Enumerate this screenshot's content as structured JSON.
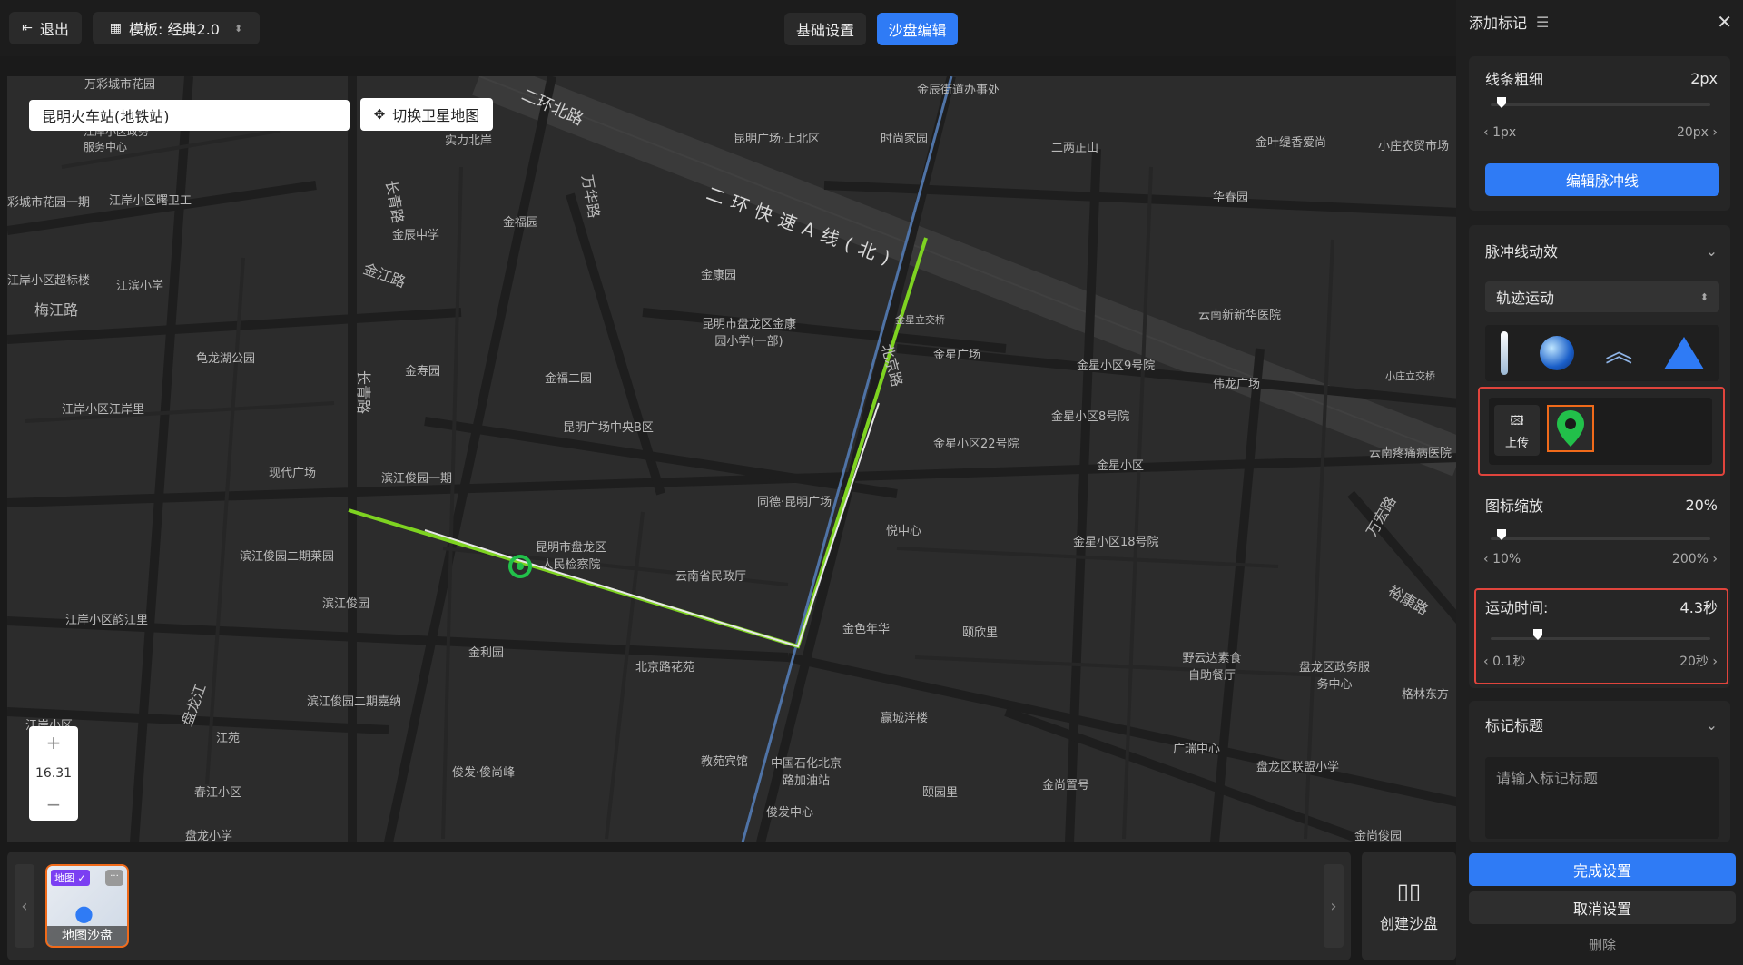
{
  "topbar": {
    "exit_label": "退出",
    "template_label": "模板: 经典2.0",
    "tab_basic": "基础设置",
    "tab_sandbox": "沙盘编辑"
  },
  "map": {
    "search_value": "昆明火车站(地铁站)",
    "satellite_button": "切换卫星地图",
    "zoom_plus": "+",
    "zoom_level": "16.31",
    "zoom_minus": "−",
    "labels": [
      "万彩城市花园",
      "江岸小区政务服务中心",
      "实力北岸",
      "金辰街道办事处",
      "二环北路",
      "昆明广场·上北区",
      "时尚家园",
      "二两正山",
      "金叶缇香爱尚",
      "小庄农贸市场",
      "二环快速A线(北)",
      "彩城市花园一期",
      "江岸小区曙卫工",
      "金辰中学",
      "金福园",
      "万华路",
      "长青路",
      "金江路",
      "华春园",
      "江岸小区超标楼",
      "江滨小学",
      "梅江路",
      "金康园",
      "昆明市盘龙区金康园小学(一部)",
      "云南新新华医院",
      "金星立交桥",
      "龟龙湖公园",
      "金寿园",
      "金福二园",
      "北京路",
      "金星广场",
      "金星小区9号院",
      "伟龙广场",
      "小庄立交桥",
      "江岸小区江岸里",
      "昆明广场中央B区",
      "金星小区8号院",
      "长青路",
      "现代广场",
      "滨江俊园一期",
      "金星小区22号院",
      "金星小区",
      "云南疼痛病医院",
      "同德·昆明广场",
      "悦中心",
      "滨江俊园二期莱园",
      "昆明市盘龙区人民检察院",
      "云南省民政厅",
      "金星小区18号院",
      "万宏路",
      "滨江俊园",
      "裕康路",
      "江岸小区韵江里",
      "金利园",
      "金色年华",
      "颐欣里",
      "北京路花苑",
      "野云达素食自助餐厅",
      "盘龙区政务服务中心",
      "滨江俊园二期嘉纳",
      "格林东方",
      "江岸小区",
      "赢城洋楼",
      "盘龙江",
      "江苑",
      "教苑宾馆",
      "中国石化北京路加油站",
      "广瑞中心",
      "盘龙区联盟小学",
      "俊发·俊尚峰",
      "春江小区",
      "颐园里",
      "金尚置号",
      "盘龙小学",
      "俊发中心",
      "金尚俊园"
    ]
  },
  "bottom": {
    "thumb_badge": "地图",
    "thumb_label": "地图沙盘",
    "create_label": "创建沙盘"
  },
  "panel": {
    "title": "添加标记",
    "line_width_label": "线条粗细",
    "line_width_value": "2px",
    "line_min": "1px",
    "line_max": "20px",
    "edit_pulse_btn": "编辑脉冲线",
    "pulse_effect_label": "脉冲线动效",
    "motion_select": "轨迹运动",
    "upload_label": "上传",
    "icon_scale_label": "图标缩放",
    "icon_scale_value": "20%",
    "icon_scale_min": "10%",
    "icon_scale_max": "200%",
    "motion_time_label": "运动时间:",
    "motion_time_value": "4.3秒",
    "motion_time_min": "0.1秒",
    "motion_time_max": "20秒",
    "marker_title_label": "标记标题",
    "marker_title_placeholder": "请输入标记标题",
    "done_btn": "完成设置",
    "cancel_btn": "取消设置",
    "delete_btn": "删除"
  },
  "colors": {
    "accent": "#2f7bf5",
    "highlight": "#e0443c",
    "route": "#7ed321",
    "marker": "#22c04a",
    "selected_border": "#f06a1a"
  }
}
